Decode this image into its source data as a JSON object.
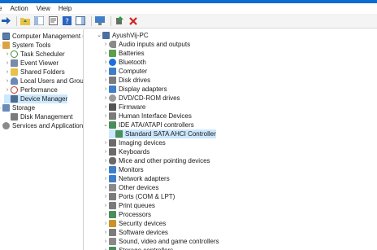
{
  "menu": [
    "e",
    "Action",
    "View",
    "Help"
  ],
  "toolbar": {
    "icons": [
      "forward-arrow-icon",
      "up-folder-icon",
      "show-hide-tree-icon",
      "properties-icon",
      "help-icon",
      "action-pane-icon",
      "monitor-icon",
      "update-driver-icon",
      "uninstall-device-icon"
    ],
    "colors": {
      "titlebar": "#0b6cd1",
      "selection": "#cce8ff"
    }
  },
  "left_tree": [
    {
      "label": "Computer Management (Local",
      "icon": "computer-management-icon",
      "exp": "",
      "indent": 0
    },
    {
      "label": "System Tools",
      "icon": "system-tools-icon",
      "exp": "⌄",
      "indent": 0
    },
    {
      "label": "Task Scheduler",
      "icon": "task-scheduler-icon",
      "exp": "›",
      "indent": 1
    },
    {
      "label": "Event Viewer",
      "icon": "event-viewer-icon",
      "exp": "›",
      "indent": 1
    },
    {
      "label": "Shared Folders",
      "icon": "shared-folders-icon",
      "exp": "›",
      "indent": 1
    },
    {
      "label": "Local Users and Groups",
      "icon": "local-users-icon",
      "exp": "›",
      "indent": 1
    },
    {
      "label": "Performance",
      "icon": "performance-icon",
      "exp": "›",
      "indent": 1
    },
    {
      "label": "Device Manager",
      "icon": "device-manager-icon",
      "exp": "",
      "indent": 1,
      "selected": true
    },
    {
      "label": "Storage",
      "icon": "storage-icon",
      "exp": "⌄",
      "indent": 0
    },
    {
      "label": "Disk Management",
      "icon": "disk-management-icon",
      "exp": "",
      "indent": 1
    },
    {
      "label": "Services and Applications",
      "icon": "services-applications-icon",
      "exp": "›",
      "indent": 0
    }
  ],
  "device_tree": [
    {
      "label": "AyushVij-PC",
      "icon": "pc-icon",
      "exp": "⌄",
      "indent": 0
    },
    {
      "label": "Audio inputs and outputs",
      "icon": "audio-icon",
      "exp": "›",
      "indent": 1
    },
    {
      "label": "Batteries",
      "icon": "battery-icon",
      "exp": "›",
      "indent": 1
    },
    {
      "label": "Bluetooth",
      "icon": "bluetooth-icon",
      "exp": "›",
      "indent": 1
    },
    {
      "label": "Computer",
      "icon": "computer-icon",
      "exp": "›",
      "indent": 1
    },
    {
      "label": "Disk drives",
      "icon": "disk-drive-icon",
      "exp": "›",
      "indent": 1
    },
    {
      "label": "Display adapters",
      "icon": "display-adapter-icon",
      "exp": "›",
      "indent": 1
    },
    {
      "label": "DVD/CD-ROM drives",
      "icon": "dvd-icon",
      "exp": "›",
      "indent": 1
    },
    {
      "label": "Firmware",
      "icon": "firmware-icon",
      "exp": "›",
      "indent": 1
    },
    {
      "label": "Human Interface Devices",
      "icon": "hid-icon",
      "exp": "›",
      "indent": 1
    },
    {
      "label": "IDE ATA/ATAPI controllers",
      "icon": "ide-controller-icon",
      "exp": "⌄",
      "indent": 1
    },
    {
      "label": "Standard SATA AHCI Controller",
      "icon": "sata-controller-icon",
      "exp": "",
      "indent": 2,
      "selected": true
    },
    {
      "label": "Imaging devices",
      "icon": "imaging-icon",
      "exp": "›",
      "indent": 1
    },
    {
      "label": "Keyboards",
      "icon": "keyboard-icon",
      "exp": "›",
      "indent": 1
    },
    {
      "label": "Mice and other pointing devices",
      "icon": "mouse-icon",
      "exp": "›",
      "indent": 1
    },
    {
      "label": "Monitors",
      "icon": "monitor-icon",
      "exp": "›",
      "indent": 1
    },
    {
      "label": "Network adapters",
      "icon": "network-icon",
      "exp": "›",
      "indent": 1
    },
    {
      "label": "Other devices",
      "icon": "other-devices-icon",
      "exp": "›",
      "indent": 1
    },
    {
      "label": "Ports (COM & LPT)",
      "icon": "ports-icon",
      "exp": "›",
      "indent": 1
    },
    {
      "label": "Print queues",
      "icon": "printer-icon",
      "exp": "›",
      "indent": 1
    },
    {
      "label": "Processors",
      "icon": "processor-icon",
      "exp": "›",
      "indent": 1
    },
    {
      "label": "Security devices",
      "icon": "security-icon",
      "exp": "›",
      "indent": 1
    },
    {
      "label": "Software devices",
      "icon": "software-icon",
      "exp": "›",
      "indent": 1
    },
    {
      "label": "Sound, video and game controllers",
      "icon": "sound-icon",
      "exp": "›",
      "indent": 1
    },
    {
      "label": "Storage controllers",
      "icon": "storage-controller-icon",
      "exp": "›",
      "indent": 1
    }
  ]
}
